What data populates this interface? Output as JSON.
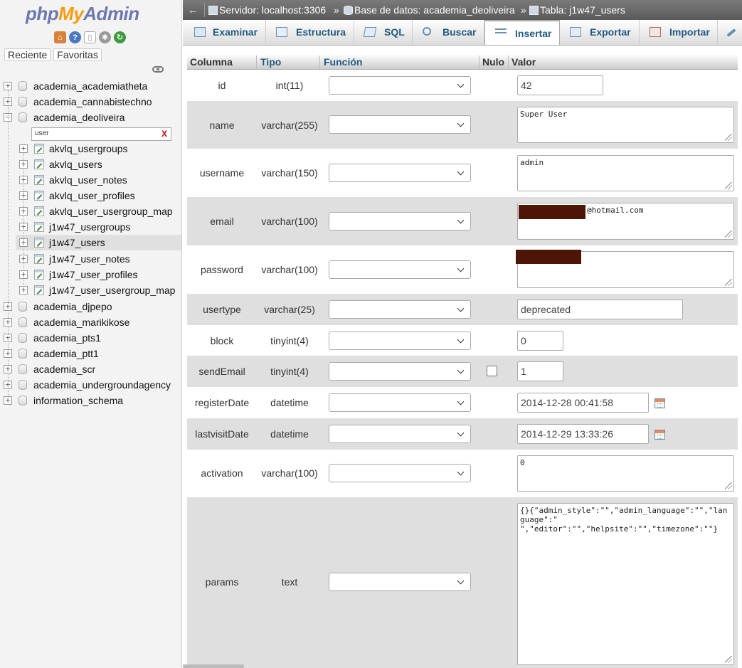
{
  "logo": {
    "php": "php",
    "my": "My",
    "admin": "Admin"
  },
  "nav_icons": [
    "home-icon",
    "info-icon",
    "docs-icon",
    "settings-icon",
    "reload-icon"
  ],
  "nav_tabs": {
    "recent": "Reciente",
    "favorites": "Favoritas"
  },
  "tree": {
    "databases_top": [
      "academia_academiatheta",
      "academia_cannabistechno",
      "academia_deoliveira"
    ],
    "filter_value": "user",
    "filter_clear": "X",
    "tables": [
      "akvlq_usergroups",
      "akvlq_users",
      "akvlq_user_notes",
      "akvlq_user_profiles",
      "akvlq_user_usergroup_map",
      "j1w47_usergroups",
      "j1w47_users",
      "j1w47_user_notes",
      "j1w47_user_profiles",
      "j1w47_user_usergroup_map"
    ],
    "selected_table": "j1w47_users",
    "databases_bottom": [
      "academia_djpepo",
      "academia_marikikose",
      "academia_pts1",
      "academia_ptt1",
      "academia_scr",
      "academia_undergroundagency",
      "information_schema"
    ],
    "expand_plus": "+",
    "expand_minus": "−"
  },
  "breadcrumb": {
    "back": "←",
    "server": "Servidor: localhost:3306",
    "database": "Base de datos: academia_deoliveira",
    "table": "Tabla: j1w47_users",
    "separator": "»"
  },
  "tabs": [
    {
      "label": "Examinar",
      "icon": "browse-icon"
    },
    {
      "label": "Estructura",
      "icon": "structure-icon"
    },
    {
      "label": "SQL",
      "icon": "sql-icon"
    },
    {
      "label": "Buscar",
      "icon": "search-icon"
    },
    {
      "label": "Insertar",
      "icon": "insert-icon"
    },
    {
      "label": "Exportar",
      "icon": "export-icon"
    },
    {
      "label": "Importar",
      "icon": "import-icon"
    },
    {
      "label": "",
      "icon": "wrench-icon"
    }
  ],
  "active_tab": "Insertar",
  "form_headers": {
    "column": "Columna",
    "type": "Tipo",
    "function": "Función",
    "null": "Nulo",
    "value": "Valor"
  },
  "fields": [
    {
      "column": "id",
      "type": "int(11)",
      "value": "42"
    },
    {
      "column": "name",
      "type": "varchar(255)",
      "value": "Super User"
    },
    {
      "column": "username",
      "type": "varchar(150)",
      "value": "admin"
    },
    {
      "column": "email",
      "type": "varchar(100)",
      "value": "@hotmail.com"
    },
    {
      "column": "password",
      "type": "varchar(100)",
      "value": ""
    },
    {
      "column": "usertype",
      "type": "varchar(25)",
      "value": "deprecated"
    },
    {
      "column": "block",
      "type": "tinyint(4)",
      "value": "0"
    },
    {
      "column": "sendEmail",
      "type": "tinyint(4)",
      "value": "1",
      "nullable": true
    },
    {
      "column": "registerDate",
      "type": "datetime",
      "value": "2014-12-28 00:41:58"
    },
    {
      "column": "lastvisitDate",
      "type": "datetime",
      "value": "2014-12-29 13:33:26"
    },
    {
      "column": "activation",
      "type": "varchar(100)",
      "value": "0"
    },
    {
      "column": "params",
      "type": "text",
      "value": "{}{\"admin_style\":\"\",\"admin_language\":\"\",\"language\":\"\n\",\"editor\":\"\",\"helpsite\":\"\",\"timezone\":\"\"}"
    }
  ],
  "colors": {
    "accent_link": "#235a81",
    "redaction": "#4e1406",
    "row_alt": "#dfdfdf"
  }
}
